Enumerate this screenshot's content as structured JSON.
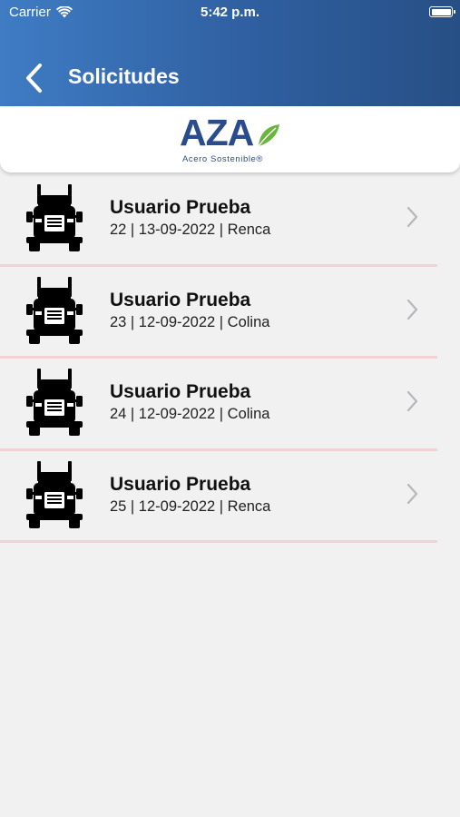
{
  "status_bar": {
    "carrier": "Carrier",
    "time": "5:42 p.m.",
    "icons": [
      "wifi-icon",
      "battery-icon"
    ]
  },
  "nav": {
    "back_icon": "chevron-left-icon",
    "title": "Solicitudes"
  },
  "logo": {
    "text": "AZA",
    "tagline": "Acero Sostenible®",
    "brand_color": "#2a4b8c",
    "leaf_color": "#6db33f"
  },
  "colors": {
    "header_start": "#3f7cc4",
    "header_end": "#274f85",
    "background": "#f1f1f2",
    "divider": "#f1d3d3"
  },
  "requests": [
    {
      "icon": "truck-icon",
      "name": "Usuario Prueba",
      "detail": "22 | 13-09-2022 | Renca"
    },
    {
      "icon": "truck-icon",
      "name": "Usuario Prueba",
      "detail": "23 | 12-09-2022 | Colina"
    },
    {
      "icon": "truck-icon",
      "name": "Usuario Prueba",
      "detail": "24 | 12-09-2022 | Colina"
    },
    {
      "icon": "truck-icon",
      "name": "Usuario Prueba",
      "detail": "25 | 12-09-2022 | Renca"
    }
  ]
}
